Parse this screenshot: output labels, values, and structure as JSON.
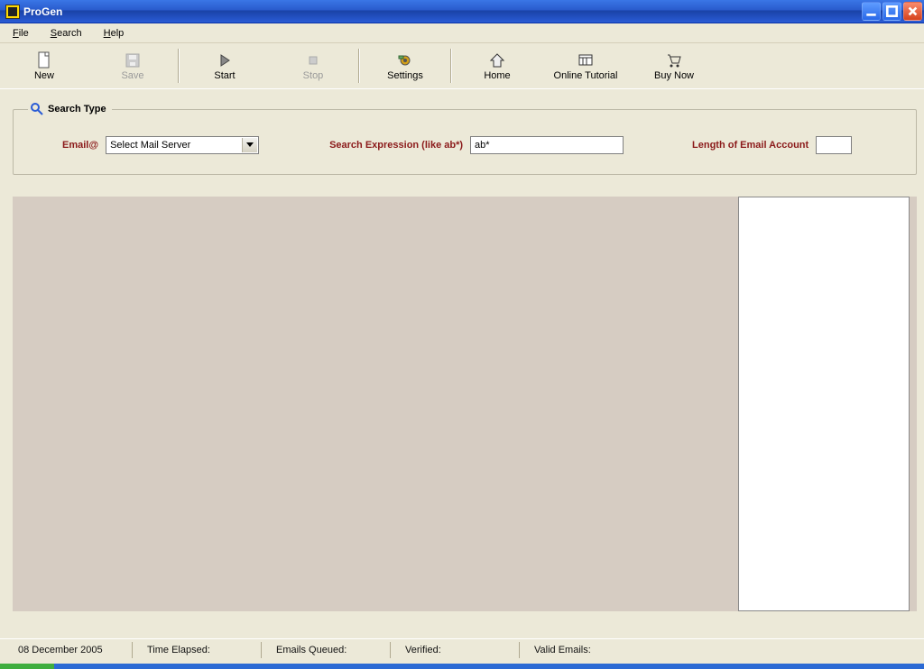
{
  "window": {
    "title": "ProGen"
  },
  "menu": {
    "file": "File",
    "search": "Search",
    "help": "Help"
  },
  "toolbar": {
    "new": "New",
    "save": "Save",
    "start": "Start",
    "stop": "Stop",
    "settings": "Settings",
    "home": "Home",
    "online_tutorial": "Online  Tutorial",
    "buy_now": "Buy Now"
  },
  "search_type": {
    "legend": "Search Type",
    "email_label": "Email@",
    "server_selected": "Select Mail Server",
    "expr_label": "Search Expression (like ab*)",
    "expr_value": "ab*",
    "len_label": "Length of Email Account",
    "len_value": ""
  },
  "status": {
    "date": "08 December 2005",
    "time_elapsed_label": "Time Elapsed:",
    "emails_queued_label": "Emails Queued:",
    "verified_label": "Verified:",
    "valid_emails_label": "Valid Emails:"
  }
}
